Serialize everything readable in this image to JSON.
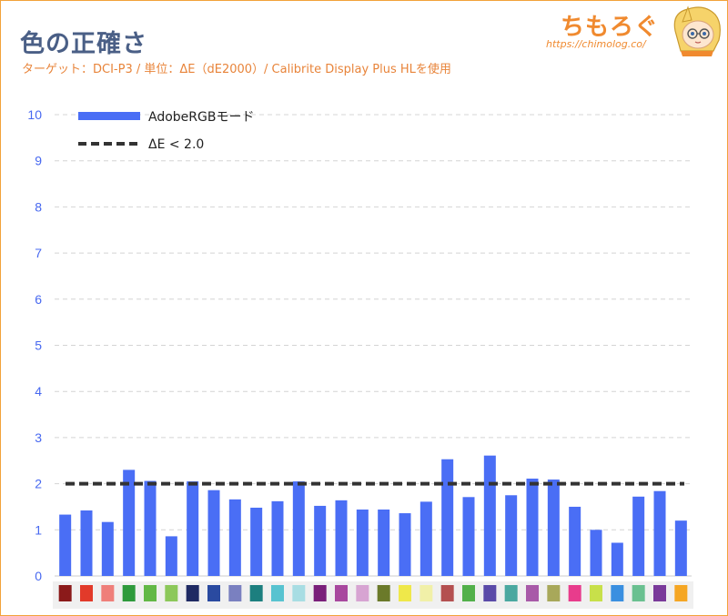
{
  "header": {
    "title": "色の正確さ",
    "subtitle": "ターゲット：DCI-P3 / 単位：ΔE（dE2000）/ Calibrite Display Plus HLを使用",
    "brand_name": "ちもろぐ",
    "brand_url": "https://chimolog.co/"
  },
  "chart_data": {
    "type": "bar",
    "title": "色の正確さ",
    "subtitle": "ターゲット：DCI-P3 / 単位：ΔE（dE2000）/ Calibrite Display Plus HLを使用",
    "ylim": [
      0,
      10
    ],
    "yticks": [
      "0",
      "1",
      "2",
      "3",
      "4",
      "5",
      "6",
      "7",
      "8",
      "9",
      "10"
    ],
    "grid": true,
    "legend_position": "top-left",
    "series": [
      {
        "name": "AdobeRGBモード",
        "color": "#4a6ef5",
        "values": [
          1.33,
          1.42,
          1.17,
          2.3,
          2.06,
          0.86,
          2.05,
          1.86,
          1.66,
          1.48,
          1.62,
          2.05,
          1.52,
          1.64,
          1.44,
          1.44,
          1.36,
          1.61,
          2.53,
          1.71,
          2.61,
          1.75,
          2.11,
          2.09,
          1.5,
          1.0,
          0.72,
          1.72,
          1.84,
          1.2
        ]
      }
    ],
    "reference_line": {
      "name": "ΔE < 2.0",
      "value": 2.0,
      "color": "#333333"
    },
    "swatches": [
      "#8b1a1a",
      "#e23a2a",
      "#ef7f7a",
      "#2e9a3c",
      "#62b846",
      "#8cc85a",
      "#1f2a63",
      "#2a4aa0",
      "#7a80c0",
      "#1c7f7f",
      "#58c3d0",
      "#a8dde3",
      "#7a1f7a",
      "#a8489e",
      "#d7a4d2",
      "#6b7a2a",
      "#efe84a",
      "#f1f0a8",
      "#b45050",
      "#52b04a",
      "#5a4aa8",
      "#4aa8a0",
      "#a85aa8",
      "#a8a85a",
      "#e83c8c",
      "#c8e04a",
      "#3a8fe0",
      "#6ac090",
      "#7a3a9a",
      "#f5a623"
    ]
  }
}
